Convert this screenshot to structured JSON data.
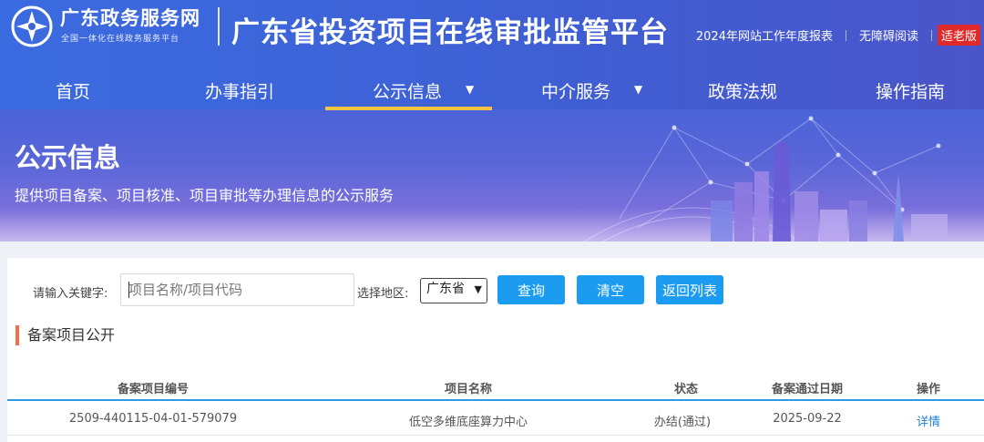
{
  "portal": {
    "name": "广东政务服务网",
    "slogan": "全国一体化在线政务服务平台"
  },
  "platform_title": "广东省投资项目在线审批监管平台",
  "top_links": {
    "report": "2024年网站工作年度报表",
    "accessibility": "无障碍阅读",
    "elder_mode": "适老版"
  },
  "nav": {
    "items": [
      {
        "label": "首页"
      },
      {
        "label": "办事指引"
      },
      {
        "label": "公示信息",
        "active": true,
        "has_dropdown": true
      },
      {
        "label": "中介服务",
        "has_dropdown": true
      },
      {
        "label": "政策法规"
      },
      {
        "label": "操作指南"
      }
    ]
  },
  "banner": {
    "title": "公示信息",
    "subtitle": "提供项目备案、项目核准、项目审批等办理信息的公示服务"
  },
  "search": {
    "keyword_label": "请输入关键字:",
    "keyword_placeholder": "项目名称/项目代码",
    "region_label": "选择地区:",
    "region_value": "广东省",
    "query_button": "查询",
    "clear_button": "清空",
    "back_button": "返回列表"
  },
  "section_title": "备案项目公开",
  "table": {
    "headers": [
      "备案项目编号",
      "项目名称",
      "状态",
      "备案通过日期",
      "操作"
    ],
    "rows": [
      {
        "code": "2509-440115-04-01-579079",
        "name": "低空多维底座算力中心",
        "status": "办结(通过)",
        "date": "2025-09-22",
        "action": "详情"
      }
    ]
  },
  "colors": {
    "header_blue": "#3f62d6",
    "active_underline": "#f5c542",
    "button_blue": "#1b9cf0",
    "section_accent": "#f0704e",
    "elder_red": "#e02a2a",
    "link_blue": "#1b7fd6"
  }
}
